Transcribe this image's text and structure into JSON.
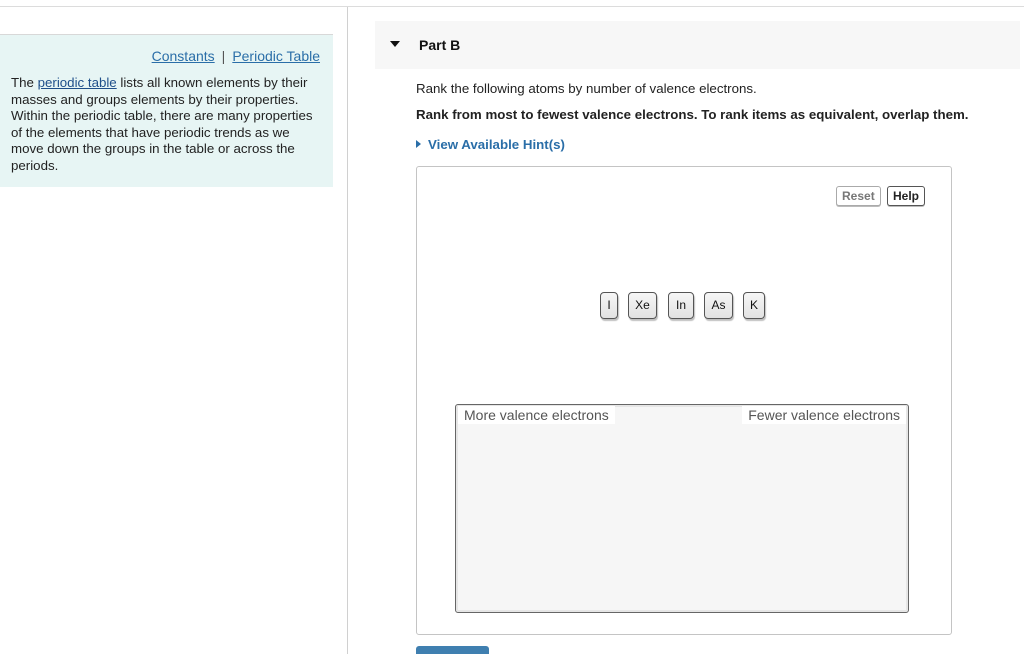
{
  "left_panel": {
    "links": {
      "constants": "Constants",
      "separator": "|",
      "periodic_table": "Periodic Table"
    },
    "intro": {
      "before": "The ",
      "link_text": "periodic table",
      "after": " lists all known elements by their masses and groups elements by their properties. Within the periodic table, there are many properties of the elements that have periodic trends as we move down the groups in the table or across the periods."
    }
  },
  "part": {
    "title": "Part B",
    "question": "Rank the following atoms by number of valence electrons.",
    "instruction": "Rank from most to fewest valence electrons. To rank items as equivalent, overlap them.",
    "hints_label": "View Available Hint(s)"
  },
  "widget": {
    "reset_label": "Reset",
    "help_label": "Help",
    "items": [
      "I",
      "Xe",
      "In",
      "As",
      "K"
    ],
    "left_label": "More valence electrons",
    "right_label": "Fewer valence electrons"
  }
}
